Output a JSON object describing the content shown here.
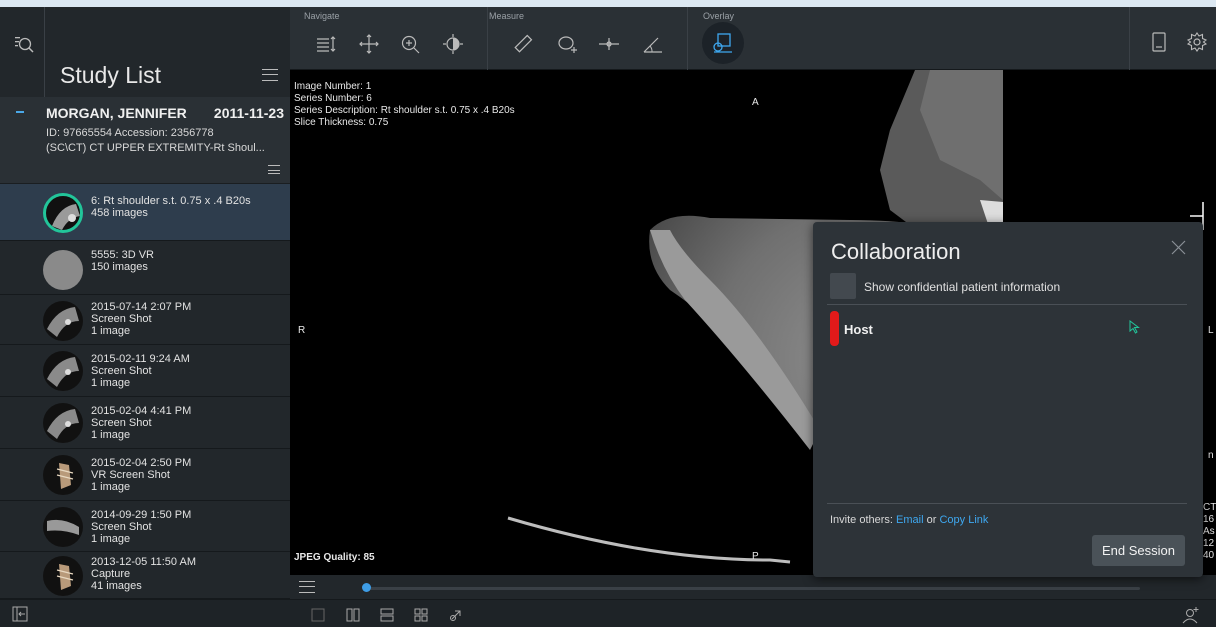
{
  "left": {
    "title": "Study List",
    "patient": {
      "name": "MORGAN, JENNIFER",
      "date": "2011-11-23",
      "ids": "ID: 97665554   Accession: 2356778",
      "description": "(SC\\CT) CT UPPER EXTREMITY-Rt Shoul..."
    },
    "series": [
      {
        "line1": "6: Rt shoulder s.t. 0.75 x .4 B20s",
        "line2": "458 images",
        "line3": ""
      },
      {
        "line1": "5555: 3D VR",
        "line2": "150 images",
        "line3": ""
      },
      {
        "line1": "2015-07-14 2:07 PM",
        "line2": "Screen Shot",
        "line3": "1 image"
      },
      {
        "line1": "2015-02-11 9:24 AM",
        "line2": "Screen Shot",
        "line3": "1 image"
      },
      {
        "line1": "2015-02-04 4:41 PM",
        "line2": "Screen Shot",
        "line3": "1 image"
      },
      {
        "line1": "2015-02-04 2:50 PM",
        "line2": "VR Screen Shot",
        "line3": "1 image"
      },
      {
        "line1": "2014-09-29 1:50 PM",
        "line2": "Screen Shot",
        "line3": "1 image"
      },
      {
        "line1": "2013-12-05 11:50 AM",
        "line2": "Capture",
        "line3": "41 images"
      }
    ]
  },
  "toolbar": {
    "navigate_label": "Navigate",
    "measure_label": "Measure",
    "overlay_label": "Overlay"
  },
  "viewport": {
    "image_number": "Image Number: 1",
    "series_number": "Series Number: 6",
    "series_description": "Series Description: Rt shoulder  s.t. 0.75 x .4  B20s",
    "slice_thickness": "Slice Thickness: 0.75",
    "orient_top": "A",
    "orient_left": "R",
    "orient_bottom": "P",
    "orient_right": "L",
    "jpeg_quality": "JPEG Quality: 85",
    "right_edge": [
      "n",
      "CT",
      "16",
      "As",
      "12",
      "40"
    ]
  },
  "dialog": {
    "title": "Collaboration",
    "checkbox_label": "Show confidential patient information",
    "host_label": "Host",
    "invite_prefix": "Invite others:",
    "email_link": "Email",
    "or_text": "or",
    "copy_link": "Copy Link",
    "end_button": "End Session"
  },
  "colors": {
    "accent": "#3ea8f0",
    "selected_ring": "#22c59a",
    "host_color": "#e21a1a"
  }
}
